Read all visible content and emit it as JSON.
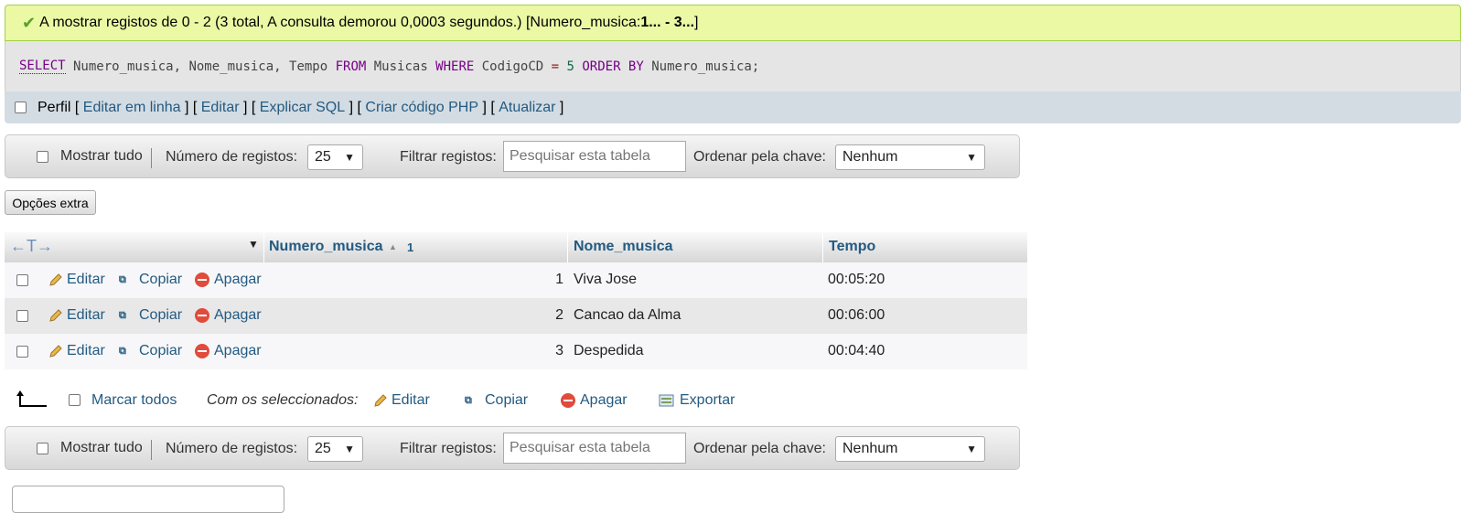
{
  "success": {
    "message": "A mostrar registos de 0 - 2 (3 total, A consulta demorou 0,0003 segundos.) [Numero_musica: ",
    "range": "1... - 3...",
    "close": "]"
  },
  "sql": {
    "k_select": "SELECT",
    "fields": " Numero_musica, Nome_musica, Tempo ",
    "k_from": "FROM",
    "table": " Musicas ",
    "k_where": "WHERE",
    "col": " CodigoCD ",
    "eq": "=",
    "value": " 5 ",
    "k_order": "ORDER BY",
    "order_col": " Numero_musica;"
  },
  "tools": {
    "profile": "Perfil",
    "links": [
      "Editar em linha",
      "Editar",
      "Explicar SQL",
      "Criar código PHP",
      "Atualizar"
    ]
  },
  "nav": {
    "show_all": "Mostrar tudo",
    "rows_label": "Número de registos:",
    "rows_value": "25",
    "filter_label": "Filtrar registos:",
    "filter_placeholder": "Pesquisar esta tabela",
    "sort_label": "Ordenar pela chave:",
    "sort_value": "Nenhum"
  },
  "extra_options": "Opções extra",
  "table": {
    "arrows": "←T→",
    "columns": [
      "Numero_musica",
      "Nome_musica",
      "Tempo"
    ],
    "sort_index": "1",
    "row_actions": {
      "edit": "Editar",
      "copy": "Copiar",
      "delete": "Apagar"
    },
    "rows": [
      {
        "numero": "1",
        "nome": "Viva Jose",
        "tempo": "00:05:20"
      },
      {
        "numero": "2",
        "nome": "Cancao da Alma",
        "tempo": "00:06:00"
      },
      {
        "numero": "3",
        "nome": "Despedida",
        "tempo": "00:04:40"
      }
    ]
  },
  "bulk": {
    "check_all": "Marcar todos",
    "with_selected": "Com os seleccionados:",
    "edit": "Editar",
    "copy": "Copiar",
    "delete": "Apagar",
    "export": "Exportar"
  },
  "colors": {
    "success_bg": "#ebf8a4",
    "link": "#235a81",
    "toolbar_bg": "#d3dce3",
    "keyword": "#770088"
  }
}
